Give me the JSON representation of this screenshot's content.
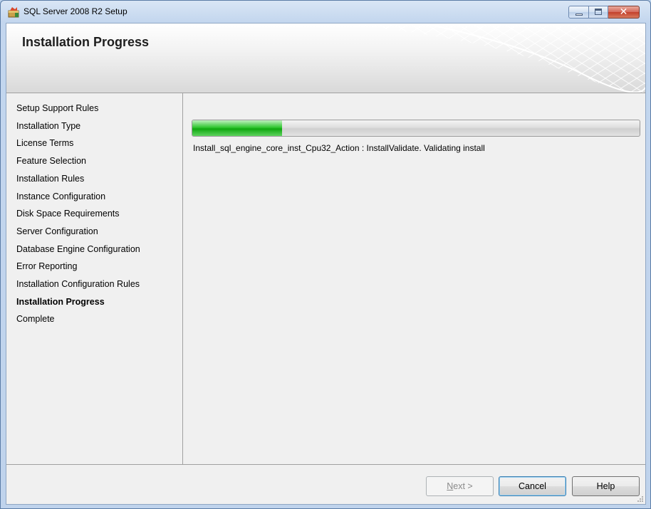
{
  "window": {
    "title": "SQL Server 2008 R2 Setup",
    "icon": "sql-setup-icon"
  },
  "header": {
    "title": "Installation Progress"
  },
  "sidebar": {
    "items": [
      {
        "label": "Setup Support Rules",
        "active": false
      },
      {
        "label": "Installation Type",
        "active": false
      },
      {
        "label": "License Terms",
        "active": false
      },
      {
        "label": "Feature Selection",
        "active": false
      },
      {
        "label": "Installation Rules",
        "active": false
      },
      {
        "label": "Instance Configuration",
        "active": false
      },
      {
        "label": "Disk Space Requirements",
        "active": false
      },
      {
        "label": "Server Configuration",
        "active": false
      },
      {
        "label": "Database Engine Configuration",
        "active": false
      },
      {
        "label": "Error Reporting",
        "active": false
      },
      {
        "label": "Installation Configuration Rules",
        "active": false
      },
      {
        "label": "Installation Progress",
        "active": true
      },
      {
        "label": "Complete",
        "active": false
      }
    ]
  },
  "main": {
    "progress_fraction": 0.2,
    "status": "Install_sql_engine_core_inst_Cpu32_Action : InstallValidate. Validating install"
  },
  "footer": {
    "next_label_mnemonic": "N",
    "next_label_rest": "ext >",
    "cancel_label": "Cancel",
    "help_label": "Help"
  },
  "colors": {
    "progress_green": "#22bb22",
    "titlebar_blue": "#c3d6ee"
  }
}
